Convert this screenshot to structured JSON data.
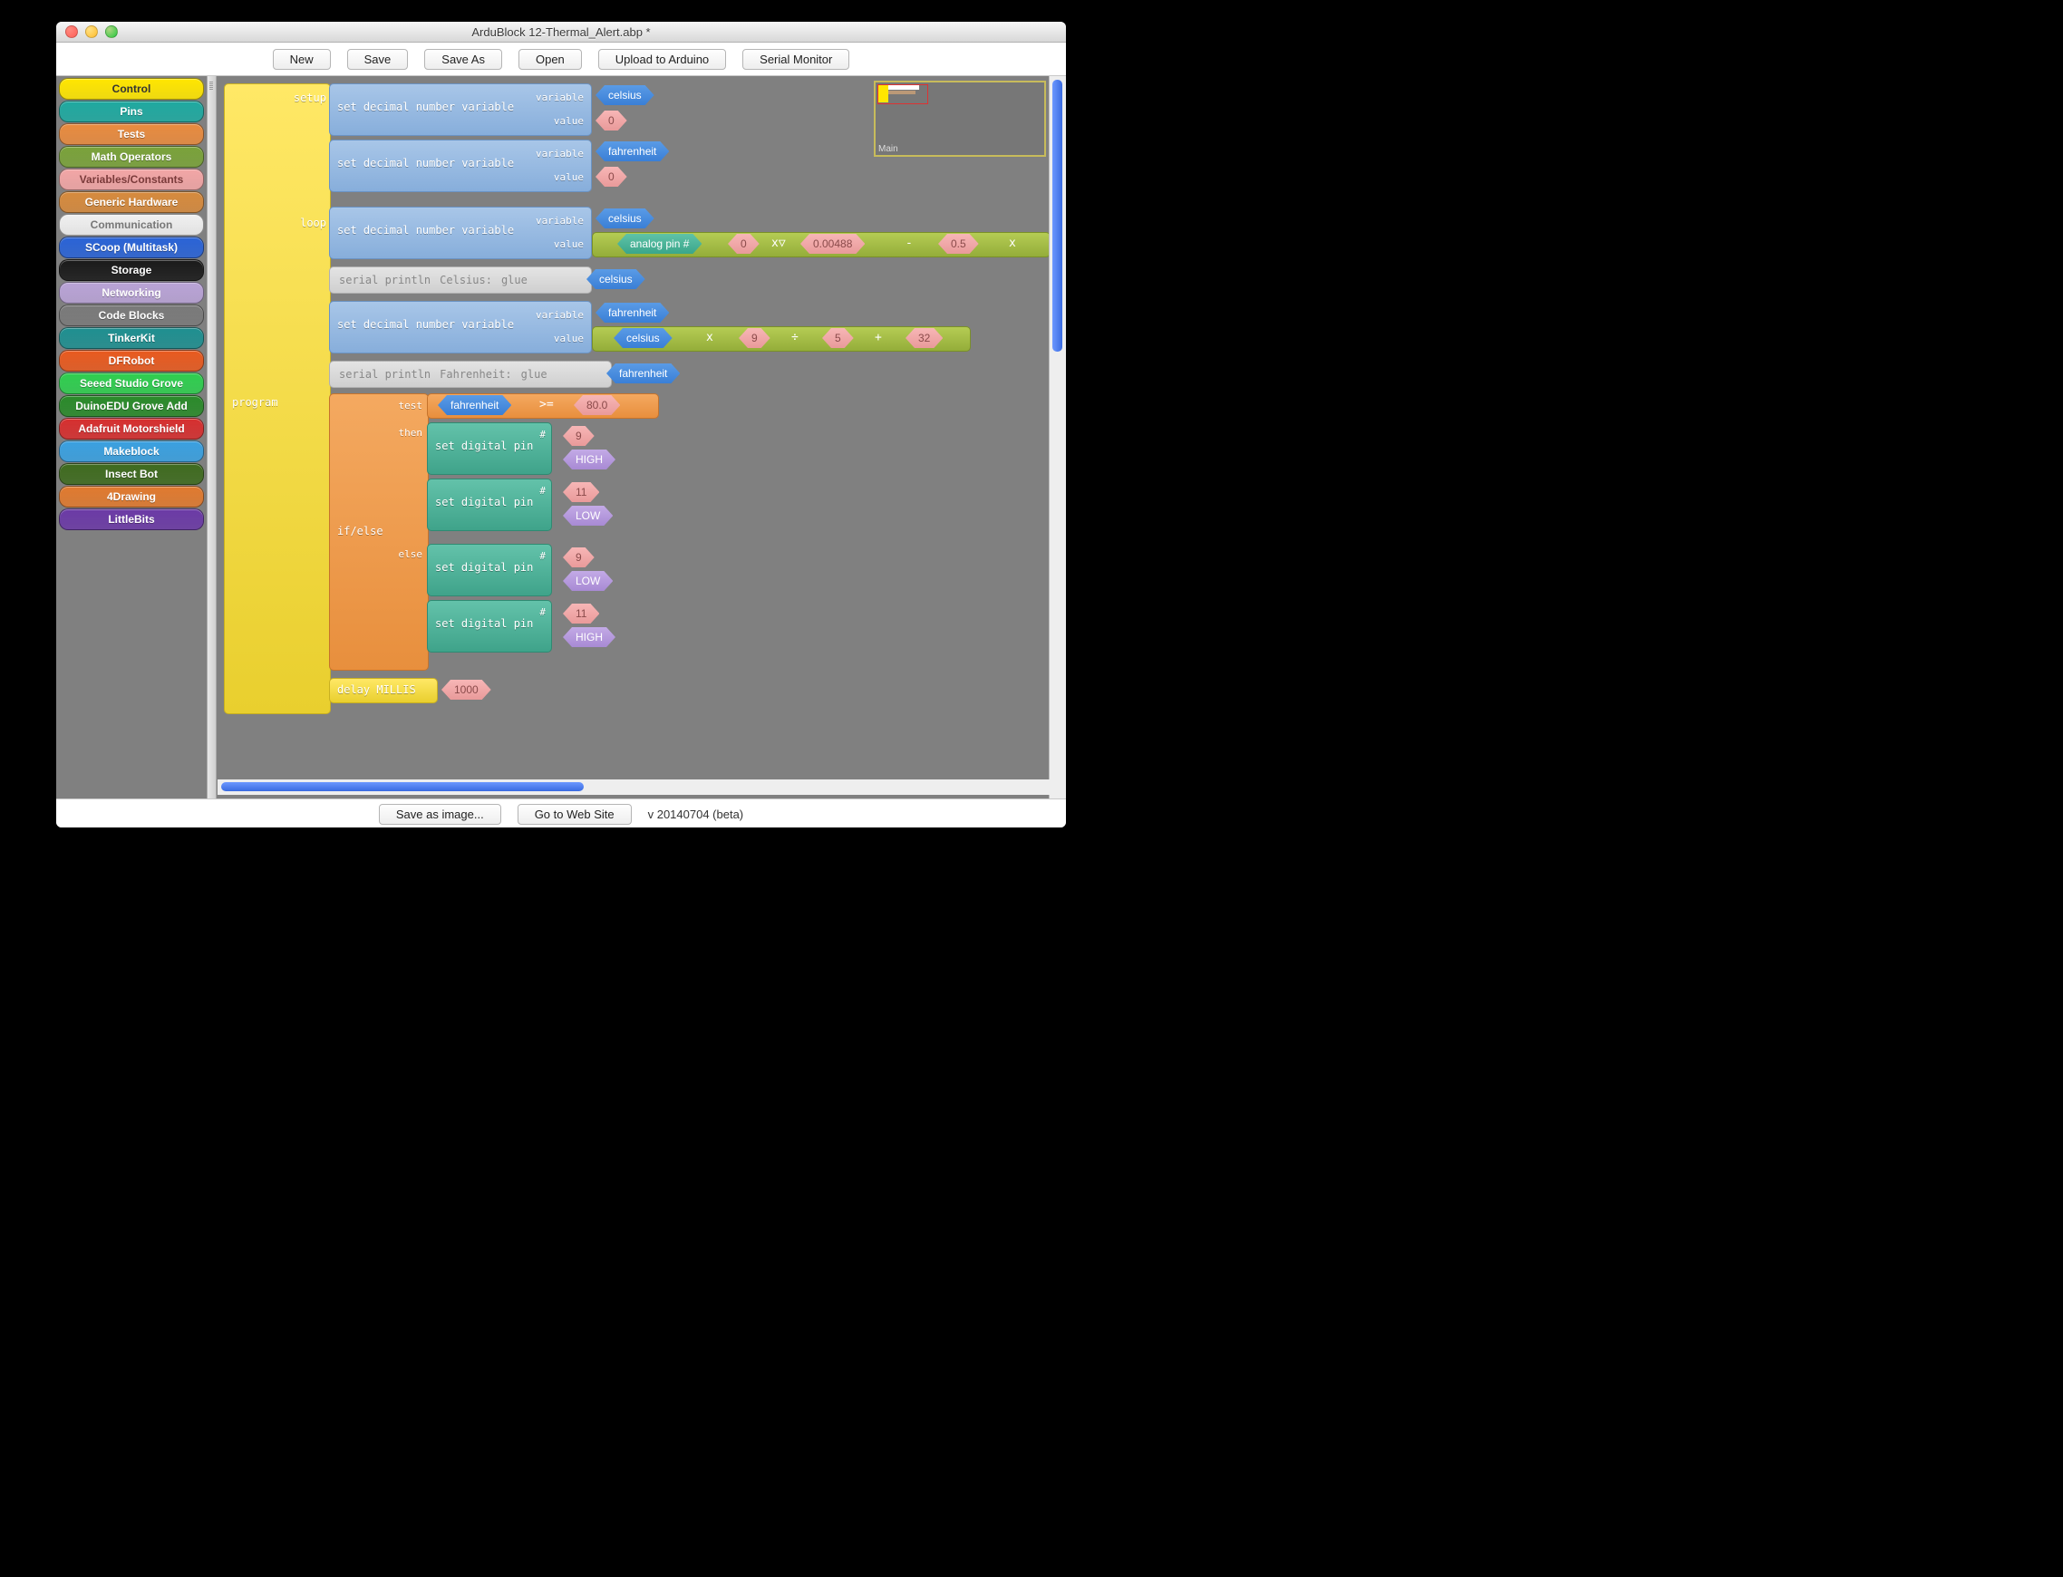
{
  "window": {
    "title": "ArduBlock 12-Thermal_Alert.abp *"
  },
  "toolbar": {
    "new": "New",
    "save": "Save",
    "saveas": "Save As",
    "open": "Open",
    "upload": "Upload to Arduino",
    "serial": "Serial Monitor"
  },
  "footer": {
    "saveimg": "Save as image...",
    "gotosite": "Go to Web Site",
    "version": "v 20140704 (beta)"
  },
  "minimap": {
    "label": "Main"
  },
  "categories": [
    {
      "label": "Control",
      "bg": "#ffe600",
      "fg": "#333"
    },
    {
      "label": "Pins",
      "bg": "#1fa9a0",
      "fg": "#fff"
    },
    {
      "label": "Tests",
      "bg": "#e88b3f",
      "fg": "#fff"
    },
    {
      "label": "Math Operators",
      "bg": "#7aa23a",
      "fg": "#fff"
    },
    {
      "label": "Variables/Constants",
      "bg": "#f2a6a6",
      "fg": "#7a3a3a"
    },
    {
      "label": "Generic Hardware",
      "bg": "#d68a3d",
      "fg": "#fff"
    },
    {
      "label": "Communication",
      "bg": "#f0f0f0",
      "fg": "#777"
    },
    {
      "label": "SCoop (Multitask)",
      "bg": "#2a63d6",
      "fg": "#fff"
    },
    {
      "label": "Storage",
      "bg": "#1a1a1a",
      "fg": "#fff"
    },
    {
      "label": "Networking",
      "bg": "#b9a3d6",
      "fg": "#fff"
    },
    {
      "label": "Code Blocks",
      "bg": "#7a7a7a",
      "fg": "#fff"
    },
    {
      "label": "TinkerKit",
      "bg": "#1f8f90",
      "fg": "#fff"
    },
    {
      "label": "DFRobot",
      "bg": "#e85a1f",
      "fg": "#fff"
    },
    {
      "label": "Seeed Studio Grove",
      "bg": "#2fce4f",
      "fg": "#fff"
    },
    {
      "label": "DuinoEDU Grove Add",
      "bg": "#2a8a2a",
      "fg": "#fff"
    },
    {
      "label": "Adafruit Motorshield",
      "bg": "#d62f2f",
      "fg": "#fff"
    },
    {
      "label": "Makeblock",
      "bg": "#3aa0e0",
      "fg": "#fff"
    },
    {
      "label": "Insect Bot",
      "bg": "#3f6b1f",
      "fg": "#fff"
    },
    {
      "label": "4Drawing",
      "bg": "#e07a2f",
      "fg": "#fff"
    },
    {
      "label": "LittleBits",
      "bg": "#6b3aa6",
      "fg": "#fff"
    }
  ],
  "blocks": {
    "program": "program",
    "setup": "setup",
    "loop": "loop",
    "setdec": "set decimal number variable",
    "variable": "variable",
    "value": "value",
    "celsius": "celsius",
    "fahrenheit": "fahrenheit",
    "zero": "0",
    "analog": "analog pin #",
    "apin": "0",
    "mult1": "0.00488",
    "sub1": "0.5",
    "println": "serial println",
    "celsiuslbl": "Celsius:",
    "fahrlbl": "Fahrenheit:",
    "glue": "glue",
    "nine": "9",
    "five": "5",
    "thirtytwo": "32",
    "ifelse": "if/else",
    "test": "test",
    "then": "then",
    "else": "else",
    "ge": ">=",
    "eighty": "80.0",
    "setdig": "set digital pin",
    "hash": "#",
    "pin9": "9",
    "pin11": "11",
    "high": "HIGH",
    "low": "LOW",
    "delay": "delay MILLIS",
    "delayval": "1000",
    "opx": "x",
    "opplus": "+",
    "opminus": "-",
    "opdiv": "÷",
    "opxtri": "x▽"
  }
}
